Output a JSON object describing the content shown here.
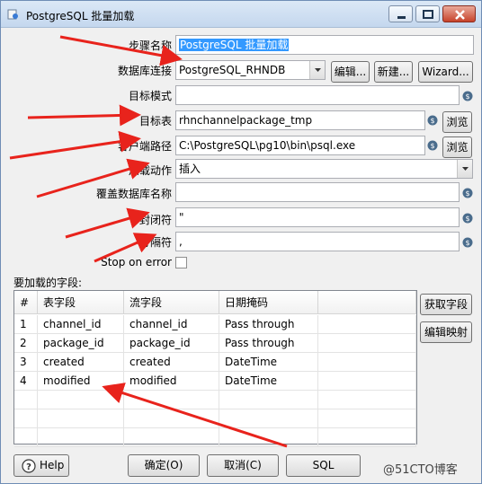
{
  "window": {
    "title": "PostgreSQL 批量加载",
    "min_icon": "minimize-icon",
    "max_icon": "maximize-icon",
    "close_icon": "close-icon"
  },
  "form": {
    "step_name_label": "步骤名称",
    "step_name_value": "PostgreSQL 批量加载",
    "connection_label": "数据库连接",
    "connection_value": "PostgreSQL_RHNDB",
    "edit_button": "编辑...",
    "new_button": "新建...",
    "wizard_button": "Wizard...",
    "schema_label": "目标模式",
    "schema_value": "",
    "table_label": "目标表",
    "table_value": "rhnchannelpackage_tmp",
    "browse_button": "浏览",
    "client_path_label": "客户端路径",
    "client_path_value": "C:\\PostgreSQL\\pg10\\bin\\psql.exe",
    "browse_button_2": "浏览",
    "load_action_label": "加载动作",
    "load_action_value": "插入",
    "override_db_label": "覆盖数据库名称",
    "override_db_value": "",
    "enclosure_label": "封闭符",
    "enclosure_value": "\"",
    "delimiter_label": "分隔符",
    "delimiter_value": ",",
    "stop_on_error_label": "Stop on error",
    "fields_label": "要加载的字段:",
    "get_fields_button": "获取字段",
    "edit_mapping_button": "编辑映射"
  },
  "table": {
    "headers": [
      "#",
      "表字段",
      "流字段",
      "日期掩码"
    ],
    "rows": [
      {
        "idx": "1",
        "table_field": "channel_id",
        "stream_field": "channel_id",
        "date_mask": "Pass through"
      },
      {
        "idx": "2",
        "table_field": "package_id",
        "stream_field": "package_id",
        "date_mask": "Pass through"
      },
      {
        "idx": "3",
        "table_field": "created",
        "stream_field": "created",
        "date_mask": "DateTime"
      },
      {
        "idx": "4",
        "table_field": "modified",
        "stream_field": "modified",
        "date_mask": "DateTime"
      }
    ]
  },
  "footer": {
    "help_button": "Help",
    "ok_button": "确定(O)",
    "cancel_button": "取消(C)",
    "sql_button": "SQL"
  },
  "watermark": "@51CTO博客",
  "colors": {
    "arrow": "#e8231c",
    "selection": "#3399ff",
    "var_icon": "#4a6c8c"
  }
}
